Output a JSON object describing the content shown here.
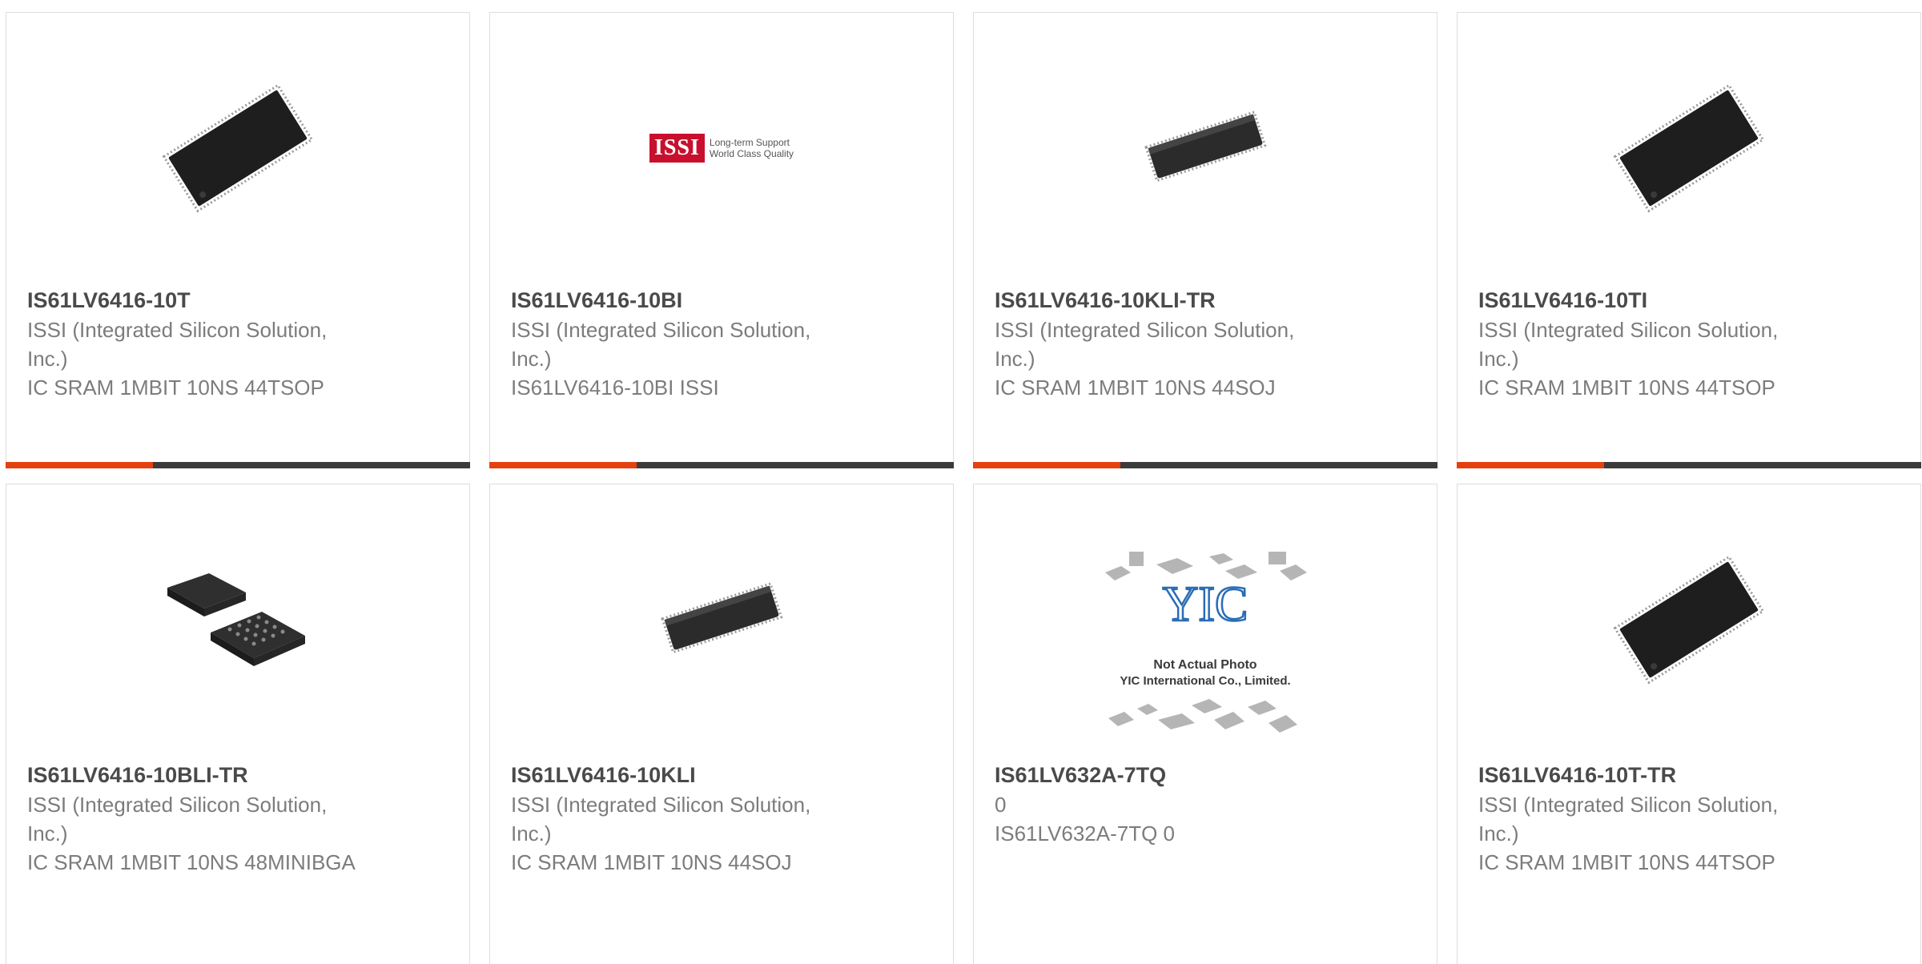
{
  "accent": "#e5400f",
  "bar_color": "#3b3b3b",
  "products": [
    {
      "part": "IS61LV6416-10T",
      "manufacturer": "ISSI (Integrated Silicon Solution, Inc.)",
      "description": "IC SRAM 1MBIT 10NS 44TSOP",
      "image": "tsop-chip"
    },
    {
      "part": "IS61LV6416-10BI",
      "manufacturer": "ISSI (Integrated Silicon Solution, Inc.)",
      "description": "IS61LV6416-10BI ISSI",
      "image": "issi-logo",
      "logo_text": "ISSI",
      "logo_tagline_1": "Long-term Support",
      "logo_tagline_2": "World Class Quality"
    },
    {
      "part": "IS61LV6416-10KLI-TR",
      "manufacturer": "ISSI (Integrated Silicon Solution, Inc.)",
      "description": "IC SRAM 1MBIT 10NS 44SOJ",
      "image": "soj-chip"
    },
    {
      "part": "IS61LV6416-10TI",
      "manufacturer": "ISSI (Integrated Silicon Solution, Inc.)",
      "description": "IC SRAM 1MBIT 10NS 44TSOP",
      "image": "tsop-chip"
    },
    {
      "part": "IS61LV6416-10BLI-TR",
      "manufacturer": "ISSI (Integrated Silicon Solution, Inc.)",
      "description": "IC SRAM 1MBIT 10NS 48MINIBGA",
      "image": "bga-chip"
    },
    {
      "part": "IS61LV6416-10KLI",
      "manufacturer": "ISSI (Integrated Silicon Solution, Inc.)",
      "description": "IC SRAM 1MBIT 10NS 44SOJ",
      "image": "soj-chip"
    },
    {
      "part": "IS61LV632A-7TQ",
      "manufacturer": "0",
      "description": "IS61LV632A-7TQ 0",
      "image": "yic-placeholder",
      "logo_text": "YIC",
      "caption_1": "Not Actual Photo",
      "caption_2": "YIC International Co., Limited."
    },
    {
      "part": "IS61LV6416-10T-TR",
      "manufacturer": "ISSI (Integrated Silicon Solution, Inc.)",
      "description": "IC SRAM 1MBIT 10NS 44TSOP",
      "image": "tsop-chip"
    }
  ]
}
